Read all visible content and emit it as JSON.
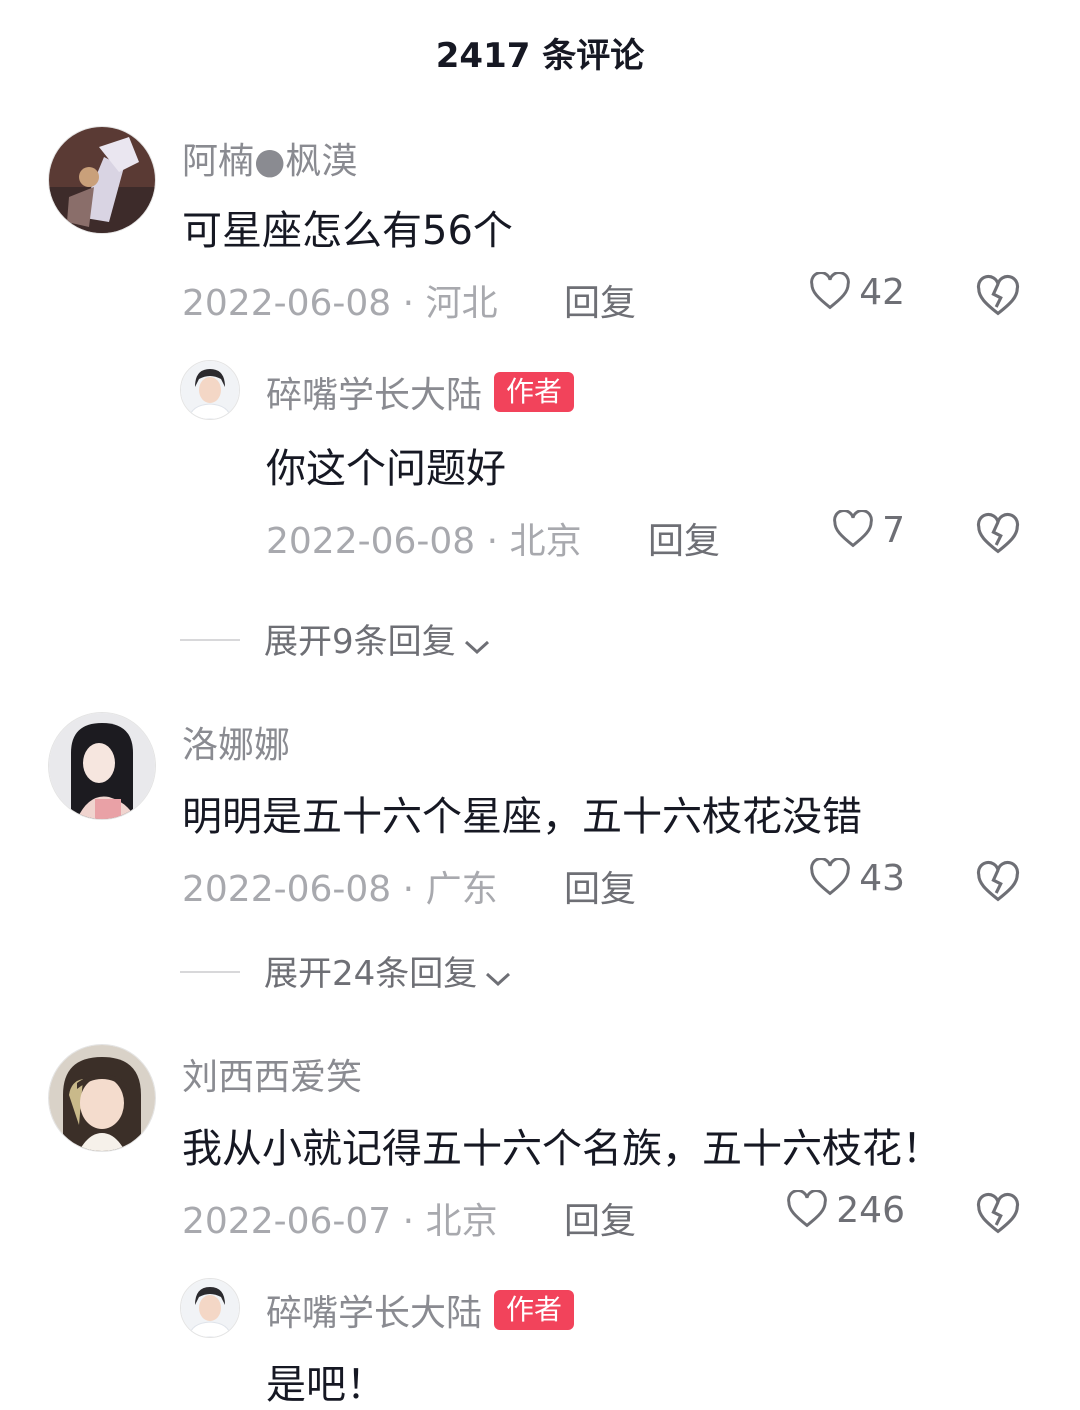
{
  "header": {
    "title": "2417 条评论"
  },
  "comments": [
    {
      "user": "阿楠●枫漠",
      "text": "可星座怎么有56个",
      "date": "2022-06-08",
      "location": "河北",
      "reply_label": "回复",
      "likes": "42",
      "replies": [
        {
          "user": "碎嘴学长大陆",
          "badge": "作者",
          "text": "你这个问题好",
          "date": "2022-06-08",
          "location": "北京",
          "reply_label": "回复",
          "likes": "7"
        }
      ],
      "expand_label": "展开9条回复"
    },
    {
      "user": "洛娜娜",
      "text": "明明是五十六个星座，五十六枝花没错",
      "date": "2022-06-08",
      "location": "广东",
      "reply_label": "回复",
      "likes": "43",
      "expand_label": "展开24条回复"
    },
    {
      "user": "刘西西爱笑",
      "text": "我从小就记得五十六个名族，五十六枝花！",
      "date": "2022-06-07",
      "location": "北京",
      "reply_label": "回复",
      "likes": "246",
      "replies": [
        {
          "user": "碎嘴学长大陆",
          "badge": "作者",
          "text": "是吧！"
        }
      ]
    }
  ],
  "meta_separator": " · ",
  "colors": {
    "badge": "#f2435b",
    "primary_text": "#161823",
    "secondary_text": "#a8a9ae"
  }
}
